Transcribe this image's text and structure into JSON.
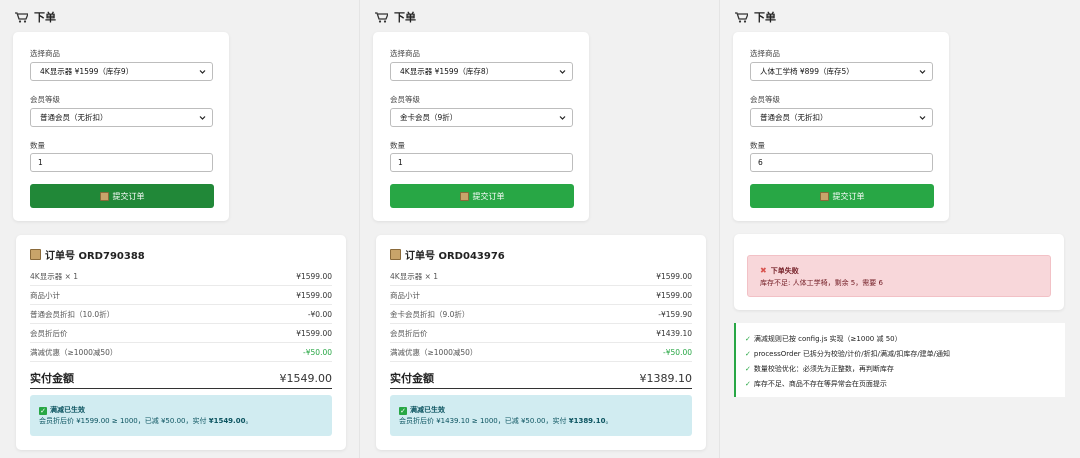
{
  "page_title": "下单",
  "form_labels": {
    "product": "选择商品",
    "member": "会员等级",
    "quantity": "数量",
    "submit": "提交订单"
  },
  "panels": [
    {
      "product": "4K显示器 ¥1599（库存9）",
      "member": "普通会员（无折扣）",
      "quantity": "1",
      "order": {
        "title": "订单号 ORD790388",
        "rows": [
          {
            "label": "4K显示器 × 1",
            "value": "¥1599.00"
          },
          {
            "label": "商品小计",
            "value": "¥1599.00"
          },
          {
            "label": "普通会员折扣（10.0折）",
            "value": "-¥0.00"
          },
          {
            "label": "会员折后价",
            "value": "¥1599.00"
          },
          {
            "label": "满减优惠（≥1000减50）",
            "value": "-¥50.00"
          }
        ],
        "total_label": "实付金额",
        "total_value": "¥1549.00",
        "promo_head": "满减已生效",
        "promo_text_prefix": "会员折后价 ¥1599.00 ≥ 1000，已减 ¥50.00，实付 ",
        "promo_text_amount": "¥1549.00",
        "promo_text_suffix": "。"
      }
    },
    {
      "product": "4K显示器 ¥1599（库存8）",
      "member": "金卡会员（9折）",
      "quantity": "1",
      "order": {
        "title": "订单号 ORD043976",
        "rows": [
          {
            "label": "4K显示器 × 1",
            "value": "¥1599.00"
          },
          {
            "label": "商品小计",
            "value": "¥1599.00"
          },
          {
            "label": "金卡会员折扣（9.0折）",
            "value": "-¥159.90"
          },
          {
            "label": "会员折后价",
            "value": "¥1439.10"
          },
          {
            "label": "满减优惠（≥1000减50）",
            "value": "-¥50.00"
          }
        ],
        "total_label": "实付金额",
        "total_value": "¥1389.10",
        "promo_head": "满减已生效",
        "promo_text_prefix": "会员折后价 ¥1439.10 ≥ 1000，已减 ¥50.00，实付 ",
        "promo_text_amount": "¥1389.10",
        "promo_text_suffix": "。"
      }
    },
    {
      "product": "人体工学椅 ¥899（库存5）",
      "member": "普通会员（无折扣）",
      "quantity": "6",
      "error": {
        "head": "下单失败",
        "text": "库存不足: 人体工学椅，剩余 5，需要 6"
      },
      "notes": [
        "满减规则已按 config.js 实现（≥1000 减 50）",
        "processOrder 已拆分为校验/计价/折扣/满减/扣库存/建单/通知",
        "数量校验优化：必须先为正整数，再判断库存",
        "库存不足、商品不存在等异常会在页面提示"
      ]
    }
  ],
  "colors": {
    "primary": "#28a745",
    "info_bg": "#d1ecf1",
    "danger_bg": "#f8d7da"
  },
  "icons": {
    "title": "cart-icon",
    "submit": "package-icon",
    "order": "package-icon",
    "promo": "checkbox-icon",
    "error": "x-icon",
    "note": "check-icon"
  }
}
